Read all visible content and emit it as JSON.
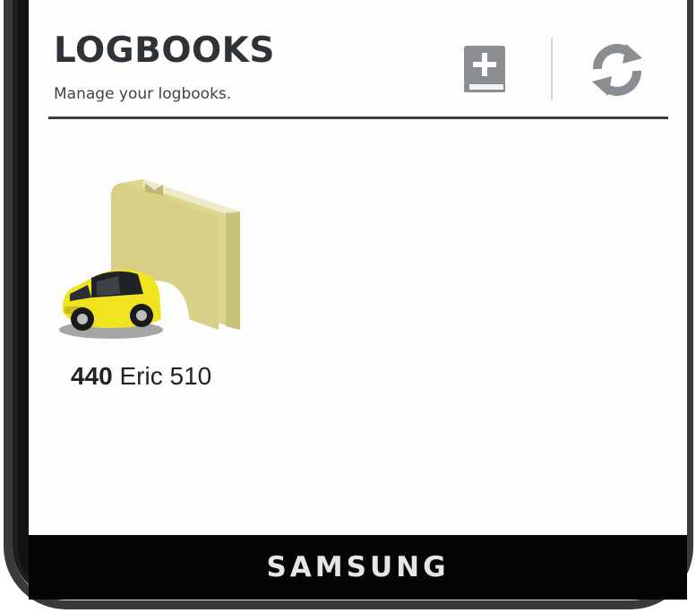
{
  "header": {
    "title": "LOGBOOKS",
    "subtitle": "Manage your logbooks."
  },
  "toolbar": {
    "add_icon": "add-book-icon",
    "refresh_icon": "refresh-icon"
  },
  "logbooks": [
    {
      "number": "440",
      "name": "Eric 510",
      "icon": "car-logbook-icon"
    }
  ],
  "device": {
    "brand": "SAMSUNG"
  },
  "colors": {
    "title": "#2f3338",
    "book": "#ddd78e",
    "car": "#f2e321",
    "icon_gray": "#8a8d91"
  }
}
